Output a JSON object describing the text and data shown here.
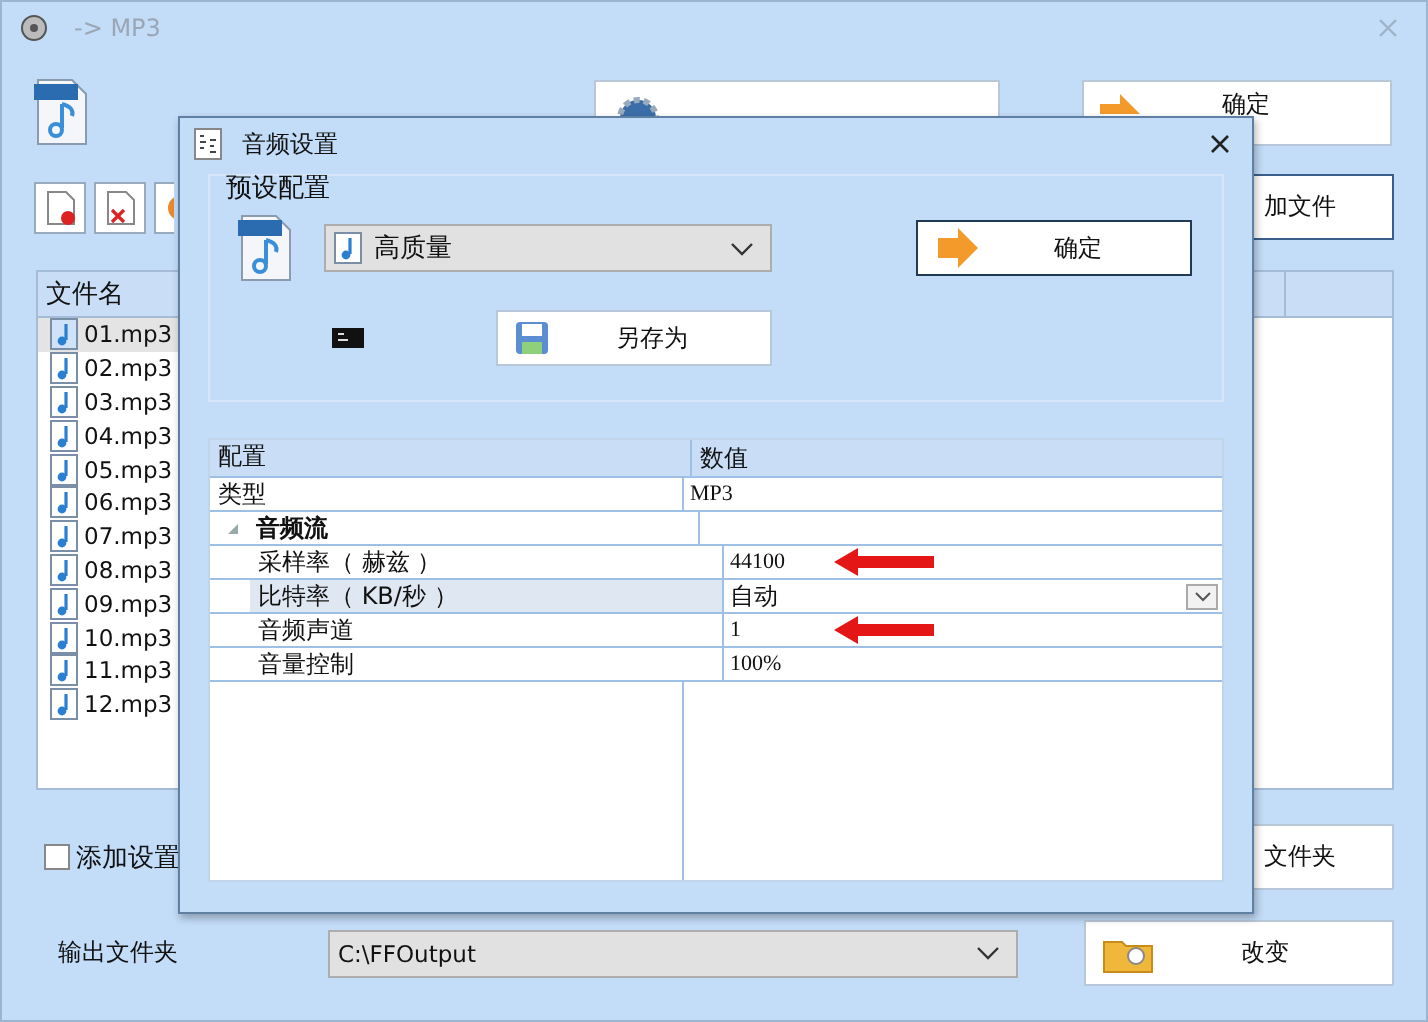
{
  "main_window": {
    "title": "-> MP3",
    "ok_button": "确定",
    "add_file_button": "加文件",
    "folder_button": "文件夹",
    "file_list": {
      "columns": [
        "文件名"
      ],
      "files": [
        {
          "name": "01.mp3",
          "selected": true
        },
        {
          "name": "02.mp3",
          "selected": false
        },
        {
          "name": "03.mp3",
          "selected": false
        },
        {
          "name": "04.mp3",
          "selected": false
        },
        {
          "name": "05.mp3",
          "selected": false
        },
        {
          "name": "06.mp3",
          "selected": false
        },
        {
          "name": "07.mp3",
          "selected": false
        },
        {
          "name": "08.mp3",
          "selected": false
        },
        {
          "name": "09.mp3",
          "selected": false
        },
        {
          "name": "10.mp3",
          "selected": false
        },
        {
          "name": "11.mp3",
          "selected": false
        },
        {
          "name": "12.mp3",
          "selected": false
        }
      ]
    },
    "add_setting_name": {
      "label": "添加设置",
      "checked": false
    },
    "output_folder": {
      "label": "输出文件夹",
      "value": "C:\\FFOutput",
      "button": "改变"
    }
  },
  "dialog": {
    "title": "音频设置",
    "preset_group": {
      "label": "预设配置",
      "preset": "高质量",
      "ok_button": "确定",
      "save_as_button": "另存为"
    },
    "properties": {
      "columns": [
        "配置",
        "数值"
      ],
      "rows": [
        {
          "kind": "property",
          "name": "类型",
          "value": "MP3",
          "selected": false,
          "annotated": false
        },
        {
          "kind": "category",
          "name": "音频流",
          "expanded": true,
          "children": [
            {
              "kind": "property",
              "name": "采样率（ 赫兹 ）",
              "value": "44100",
              "selected": false,
              "annotated": true
            },
            {
              "kind": "dropdown",
              "name": "比特率（ KB/秒 ）",
              "value": "自动",
              "selected": true,
              "annotated": false
            },
            {
              "kind": "property",
              "name": "音频声道",
              "value": "1",
              "selected": false,
              "annotated": true
            },
            {
              "kind": "property",
              "name": "音量控制",
              "value": "100%",
              "selected": false,
              "annotated": false
            }
          ]
        }
      ]
    }
  }
}
